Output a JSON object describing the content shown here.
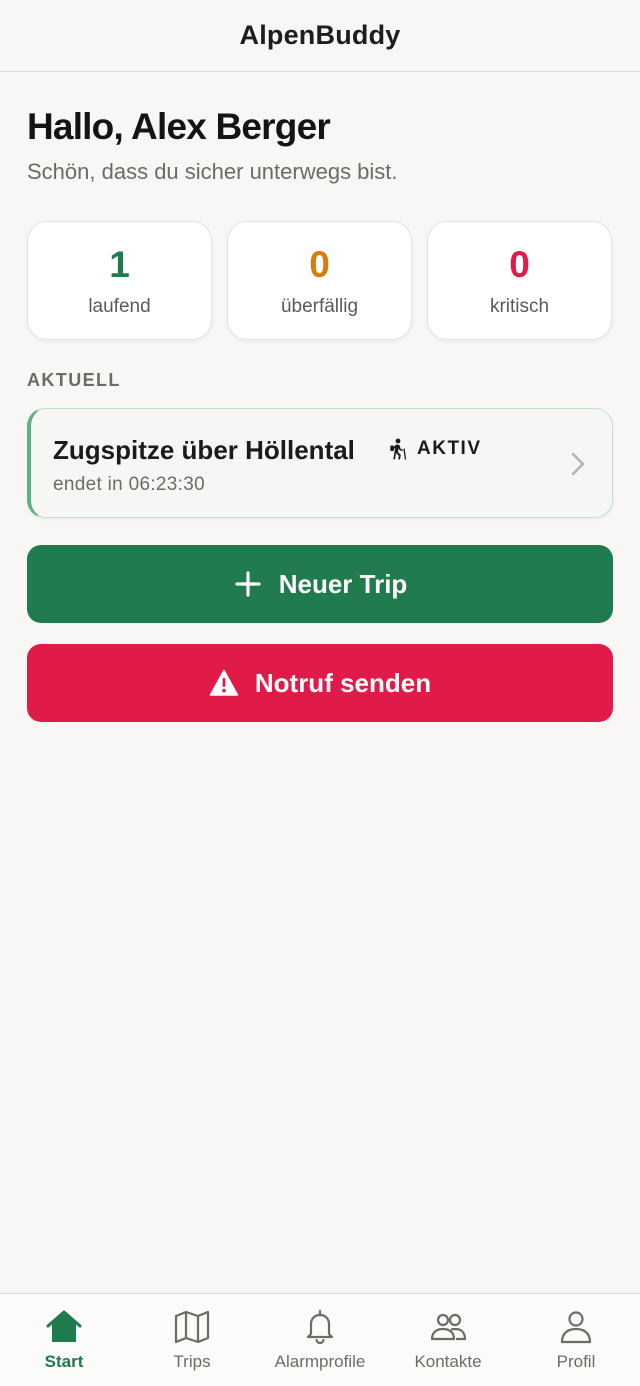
{
  "app": {
    "title": "AlpenBuddy"
  },
  "greeting": {
    "title": "Hallo, Alex Berger",
    "subtitle": "Schön, dass du sicher unterwegs bist."
  },
  "stats": [
    {
      "value": "1",
      "label": "laufend",
      "color": "#1f7a4d"
    },
    {
      "value": "0",
      "label": "überfällig",
      "color": "#d97c07"
    },
    {
      "value": "0",
      "label": "kritisch",
      "color": "#e01a4a"
    }
  ],
  "current": {
    "section_label": "AKTUELL",
    "trip": {
      "title": "Zugspitze über Höllental",
      "status": "AKTIV",
      "status_icon": "hiker-icon",
      "subtitle": "endet in 06:23:30"
    }
  },
  "actions": {
    "new_trip": {
      "label": "Neuer Trip",
      "icon": "plus-icon",
      "color": "#207b4e"
    },
    "sos": {
      "label": "Notruf senden",
      "icon": "warning-icon",
      "color": "#e11b49"
    }
  },
  "nav": {
    "active": "Start",
    "items": [
      {
        "label": "Start",
        "icon": "home-icon"
      },
      {
        "label": "Trips",
        "icon": "map-icon"
      },
      {
        "label": "Alarmprofile",
        "icon": "bell-icon"
      },
      {
        "label": "Kontakte",
        "icon": "contacts-icon"
      },
      {
        "label": "Profil",
        "icon": "profile-icon"
      }
    ]
  }
}
